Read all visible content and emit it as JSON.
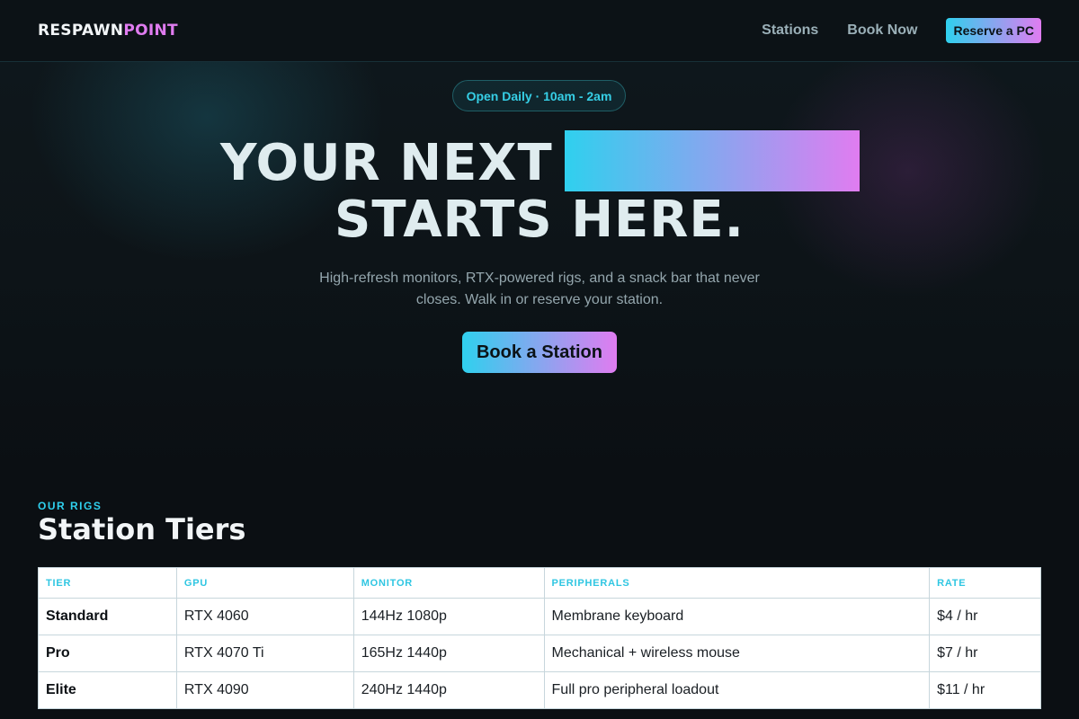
{
  "brand": {
    "logo_part1": "RESPAWN",
    "logo_part2": "POINT"
  },
  "nav": {
    "links": [
      "Stations",
      "Book Now"
    ],
    "cta": "Reserve a PC"
  },
  "hero": {
    "badge": "Open Daily · 10am - 2am",
    "headline_line1": "YOUR NEXT",
    "headline_line2": "STARTS HERE.",
    "subtitle": "High-refresh monitors, RTX-powered rigs, and a snack bar that never closes. Walk in or reserve your station.",
    "cta": "Book a Station"
  },
  "tiers_section": {
    "eyebrow": "OUR RIGS",
    "title": "Station Tiers",
    "columns": [
      "TIER",
      "GPU",
      "MONITOR",
      "PERIPHERALS",
      "RATE"
    ],
    "rows": [
      [
        "Standard",
        "RTX 4060",
        "144Hz 1080p",
        "Membrane keyboard",
        "$4 / hr"
      ],
      [
        "Pro",
        "RTX 4070 Ti",
        "165Hz 1440p",
        "Mechanical + wireless mouse",
        "$7 / hr"
      ],
      [
        "Elite",
        "RTX 4090",
        "240Hz 1440p",
        "Full pro peripheral loadout",
        "$11 / hr"
      ]
    ]
  },
  "colors": {
    "accent_cyan": "#2fd0ee",
    "accent_pink": "#e07cf0",
    "background": "#0b0f13"
  }
}
